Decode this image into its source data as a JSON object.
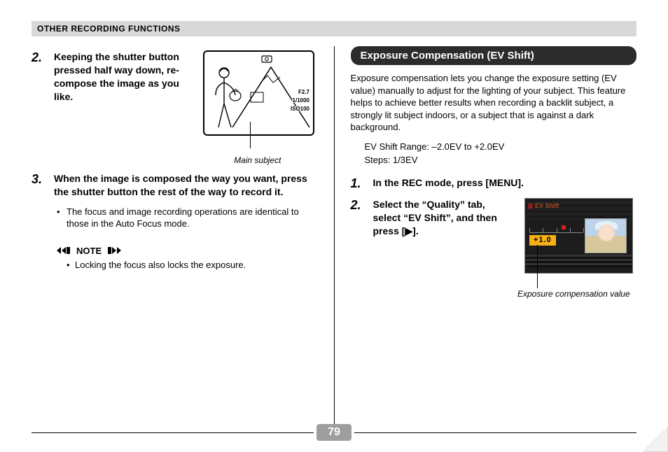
{
  "header": "OTHER RECORDING FUNCTIONS",
  "left": {
    "step2": {
      "num": "2.",
      "text": "Keeping the shutter button pressed half way down, re-compose the image as you like."
    },
    "illus": {
      "f": "F2.7",
      "shutter": "1/1000",
      "iso": "ISO100",
      "caption": "Main subject"
    },
    "step3": {
      "num": "3.",
      "text": "When the image is composed the way you want, press the shutter button the rest of the way to record it."
    },
    "bullet1": "The focus and image recording operations are identical to those in the Auto Focus mode.",
    "note_label": "NOTE",
    "note1": "Locking the focus also locks the exposure."
  },
  "right": {
    "heading": "Exposure Compensation (EV Shift)",
    "para": "Exposure compensation lets you change the exposure setting (EV value) manually to adjust for the lighting of your subject. This feature helps to achieve better results when recording a backlit subject, a strongly lit subject indoors, or a subject that is against a dark background.",
    "range": "EV Shift Range: –2.0EV to +2.0EV",
    "steps_line": "Steps: 1/3EV",
    "step1": {
      "num": "1.",
      "text": "In the REC mode, press [MENU]."
    },
    "step2": {
      "num": "2.",
      "text": "Select the “Quality” tab, select “EV Shift”, and then press [▶]."
    },
    "screen": {
      "title": "EV Shift",
      "value": "+1.0",
      "caption": "Exposure compensation value"
    }
  },
  "page_number": "79"
}
